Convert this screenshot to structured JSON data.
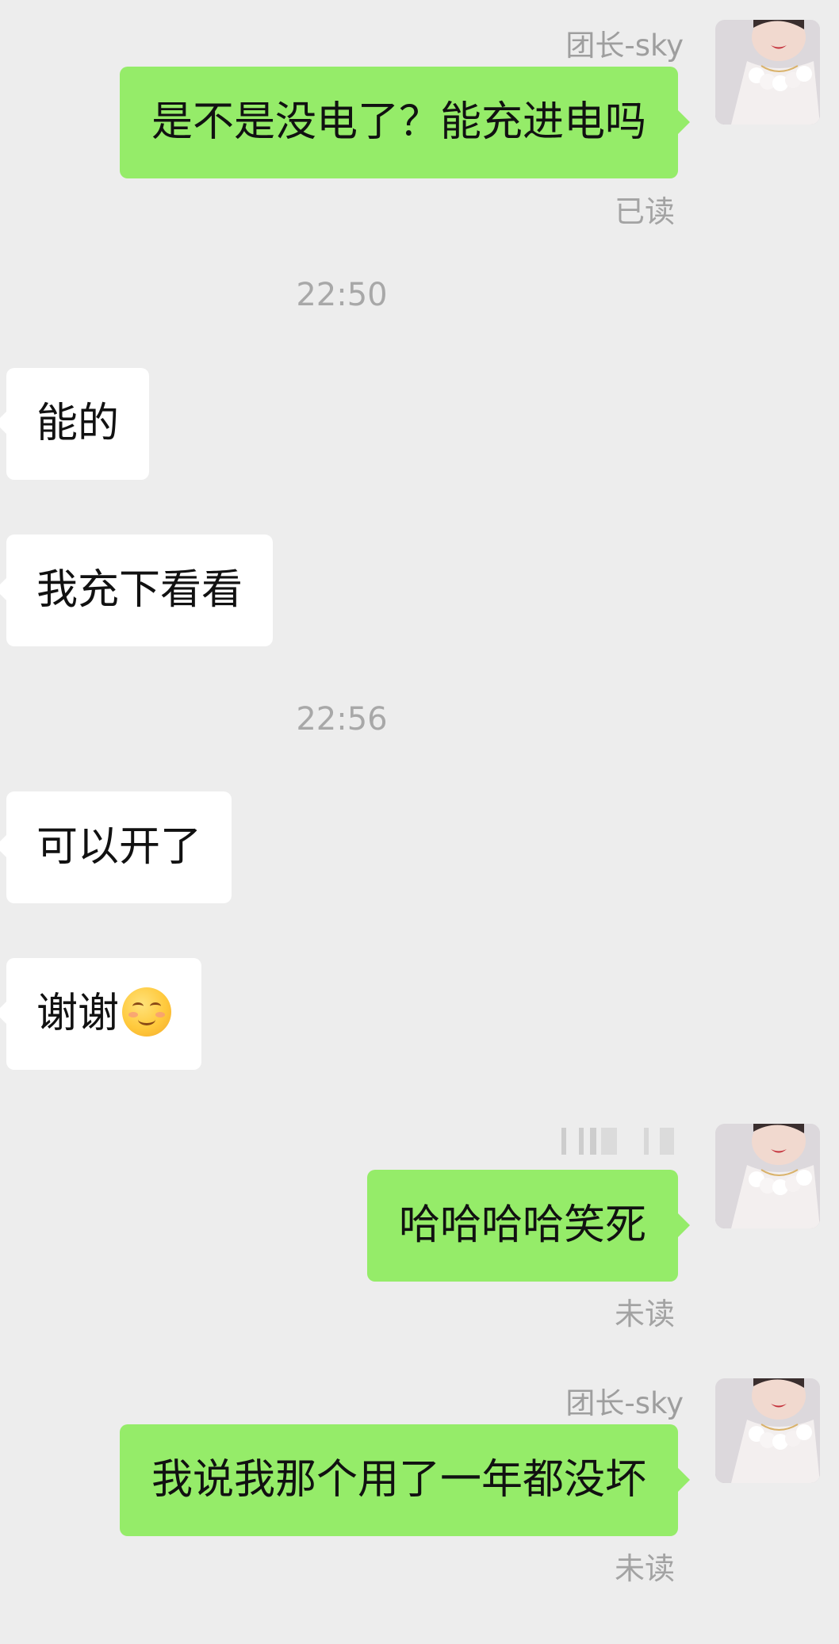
{
  "chat": {
    "messages": [
      {
        "sender_name": "团长-sky",
        "text": "是不是没电了？能充进电吗",
        "read_status": "已读"
      },
      {
        "time": "22:50"
      },
      {
        "text": "能的"
      },
      {
        "text": "我充下看看"
      },
      {
        "time": "22:56"
      },
      {
        "text": "可以开了"
      },
      {
        "text": "谢谢",
        "emoji": "smiling-face-with-blush-emoji"
      },
      {
        "text": "哈哈哈哈笑死",
        "read_status": "未读"
      },
      {
        "sender_name": "团长-sky",
        "text": "我说我那个用了一年都没坏",
        "read_status": "未读"
      }
    ]
  },
  "colors": {
    "background": "#ededed",
    "my_bubble": "#95ec69",
    "other_bubble": "#ffffff",
    "muted_text": "#a3a3a3"
  }
}
